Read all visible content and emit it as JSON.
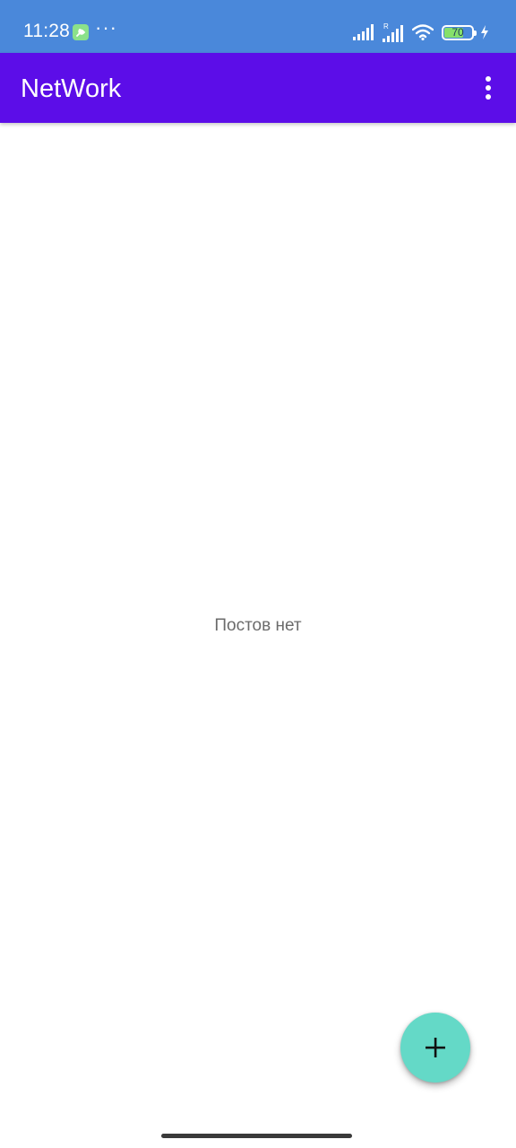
{
  "status_bar": {
    "time": "11:28",
    "more_indicator": "···",
    "roaming_indicator": "R",
    "battery_percent": 70,
    "battery_text": "70",
    "charging": true,
    "icons": [
      "app-notification-icon",
      "cell-signal-icon",
      "cell-signal-roaming-icon",
      "wifi-icon",
      "battery-icon",
      "charging-bolt-icon"
    ]
  },
  "app_bar": {
    "title": "NetWork",
    "overflow_icon": "more-vert-icon"
  },
  "content": {
    "empty_message": "Постов нет"
  },
  "fab": {
    "icon": "plus-icon"
  },
  "colors": {
    "status_bar": "#4a88da",
    "app_bar": "#5c0de8",
    "fab": "#64d9c7",
    "empty_text": "#6b6b6b",
    "battery_fill": "#86e06b"
  }
}
